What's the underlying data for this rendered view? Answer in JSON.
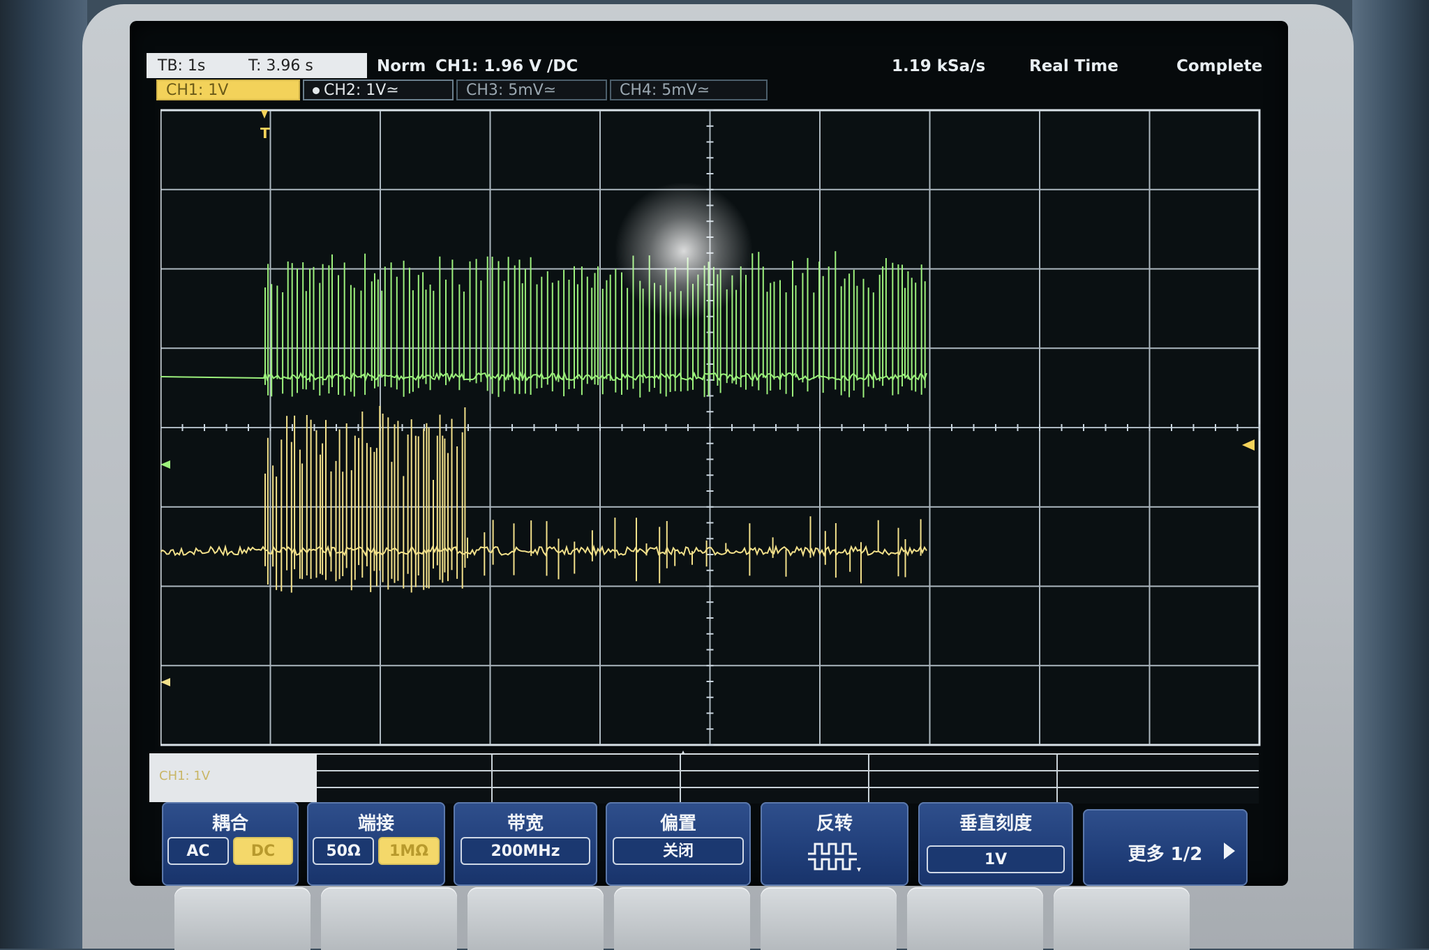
{
  "status_bar": {
    "timebase": "TB: 1s",
    "trigger_time": "T: 3.96 s",
    "trigger_mode": "Norm",
    "trigger_source": "CH1: 1.96 V ∕DC",
    "sample_rate": "1.19 kSa/s",
    "acquisition_mode": "Real Time",
    "acquisition_state": "Complete"
  },
  "channels": [
    {
      "label": "CH1: 1V",
      "state": "active"
    },
    {
      "label": "CH2: 1V≃",
      "state": "on"
    },
    {
      "label": "CH3: 5mV≃",
      "state": "off"
    },
    {
      "label": "CH4: 5mV≃",
      "state": "off"
    }
  ],
  "markers": {
    "trigger": "T"
  },
  "colors": {
    "ch1": "#f2e08a",
    "ch2": "#9cf07c",
    "grid": "#c9d5de",
    "menu": "#203e79"
  },
  "menu": {
    "coupling": {
      "title": "耦合",
      "ac": "AC",
      "dc": "DC"
    },
    "termination": {
      "title": "端接",
      "ohm50": "50Ω",
      "mohm1": "1MΩ"
    },
    "bandwidth": {
      "title": "带宽",
      "value": "200MHz"
    },
    "offset": {
      "title": "偏置",
      "value": "关闭"
    },
    "invert": {
      "title": "反转"
    },
    "vertical_scale": {
      "title": "垂直刻度",
      "value": "1V"
    },
    "more": {
      "label": "更多 1/2"
    }
  }
}
